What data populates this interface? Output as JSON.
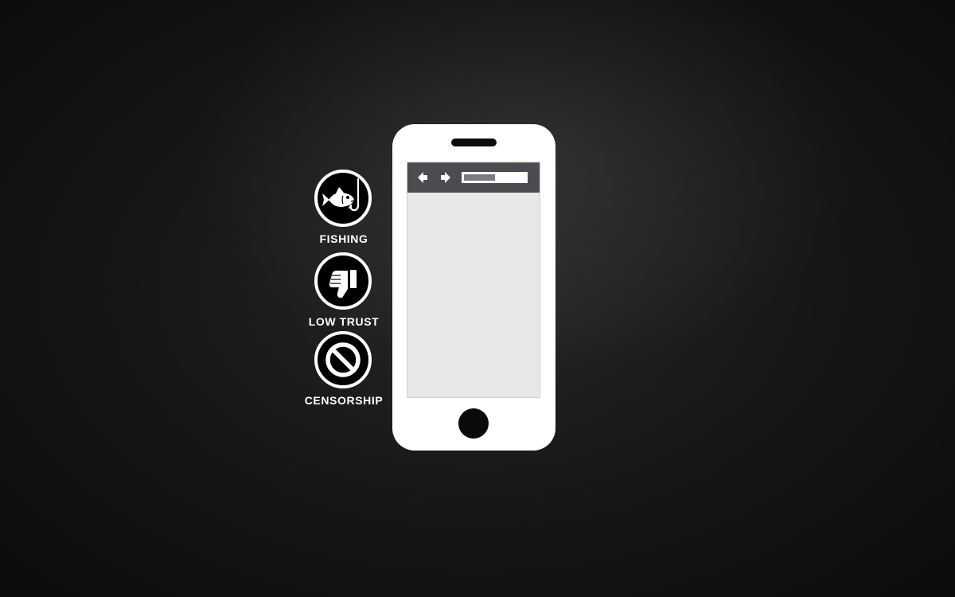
{
  "threats": [
    {
      "label": "FISHING",
      "icon": "fish-hook-icon"
    },
    {
      "label": "LOW TRUST",
      "icon": "thumbs-down-icon"
    },
    {
      "label": "CENSORSHIP",
      "icon": "prohibited-icon"
    }
  ],
  "phone": {
    "browser": {
      "back_icon": "arrow-left-icon",
      "forward_icon": "arrow-right-icon",
      "load_progress": 0.5
    }
  },
  "colors": {
    "background": "#1a1a1a",
    "phone_body": "#ffffff",
    "screen": "#e8e8e8",
    "browser_bar": "#4a4c50",
    "icon_fill": "#000000",
    "text": "#ffffff"
  }
}
